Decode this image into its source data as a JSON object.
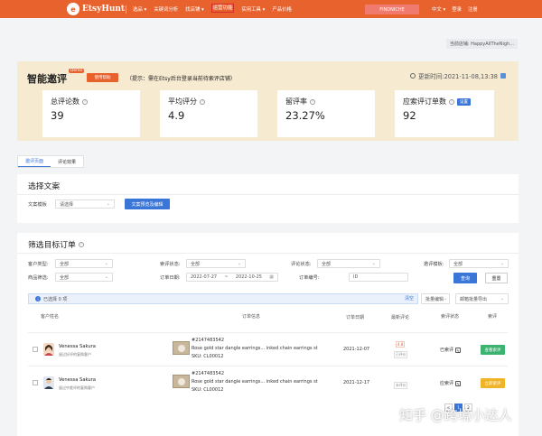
{
  "topnav": {
    "logo_text": "EtsyHunt",
    "items": [
      {
        "label": "选品 ▾",
        "active": false
      },
      {
        "label": "关键词分析",
        "active": false
      },
      {
        "label": "找店铺 ▾",
        "active": false
      },
      {
        "label": "运营功能",
        "active": true
      },
      {
        "label": "实用工具 ▾",
        "active": false
      },
      {
        "label": "产品价格",
        "active": false
      }
    ],
    "findniche_label": "FINDNICHE",
    "lang_label": "中文 ▾",
    "login_label": "登录",
    "register_label": "注册"
  },
  "current_shop": "当前店铺: HappyAllTheNigh...",
  "hero": {
    "title": "智能邀评",
    "demo_badge": "Demo",
    "help_button": "使用帮助",
    "hint": "（提示：需在Etsy后台登录当前待索评店铺）",
    "update_time": "更新时间:2021-11-08,13:38"
  },
  "stats": [
    {
      "label": "总评论数",
      "value": "39"
    },
    {
      "label": "平均评分",
      "value": "4.9"
    },
    {
      "label": "留评率",
      "value": "23.27%"
    },
    {
      "label": "应索评订单数",
      "value": "92",
      "button": "设置"
    }
  ],
  "tabs": [
    {
      "label": "邀评页面",
      "active": true
    },
    {
      "label": "评论效果",
      "active": false
    }
  ],
  "copy_section": {
    "title": "选择文案",
    "template_label": "文案模板",
    "template_select": "请选择",
    "preview_button": "文案预览及编辑"
  },
  "filter_section": {
    "title": "筛选目标订单",
    "customer_type_label": "客户类型:",
    "customer_type_value": "全部",
    "review_status_label": "索评状态:",
    "review_status_value": "全部",
    "comment_status_label": "评论状态:",
    "comment_status_value": "全部",
    "review_template_label": "邀评模板:",
    "review_template_value": "全部",
    "product_filter_label": "商品筛选:",
    "product_filter_value": "全部",
    "order_date_label": "订单日期:",
    "date_start": "2022-07-27",
    "date_sep": "~",
    "date_end": "2022-10-25",
    "order_no_label": "订单编号:",
    "order_no_value": "ID",
    "query_button": "查询",
    "reset_button": "重置"
  },
  "selection": {
    "selected_text": "已选择 0 项",
    "clear_label": "清空",
    "batch_edit": "批量编辑",
    "batch_export": "邮箱批量导出"
  },
  "table": {
    "headers": {
      "customer": "客户姓名",
      "order_info": "订单信息",
      "order_date": "订单日期",
      "latest_review": "最新评论",
      "review_status": "索评状态",
      "action": "索评"
    },
    "rows": [
      {
        "name": "Venessa Sakura",
        "desc": "留过好评的复购客户",
        "order_id": "#2147483542",
        "product": "Rose gold star dangle earrings... inked chain earrings st",
        "sku": "SKU:  CL00012",
        "date": "2021-12-07",
        "stars": "4.8",
        "review_tag": "已评价",
        "status": "已索评",
        "action": "查看索评",
        "action_color": "#3cb371"
      },
      {
        "name": "Venessa Sakura",
        "desc": "留过中差评的复购客户",
        "order_id": "#2147483542",
        "product": "Rose gold star dangle earrings... inked chain earrings st",
        "sku": "SKU:  CL00012",
        "date": "2021-12-17",
        "stars": "",
        "review_tag": "未评价",
        "status": "应索评",
        "action": "立即索评",
        "action_color": "#f0b429"
      }
    ]
  },
  "pager": [
    "<",
    "1",
    "2"
  ],
  "watermark": "知乎 @跨境小达人",
  "colors": {
    "brand": "#e8622e",
    "primary": "#3a76d8",
    "hero_bg": "#f6ead1"
  }
}
